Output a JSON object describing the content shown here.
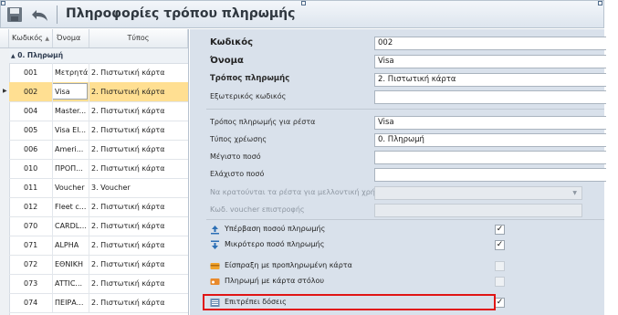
{
  "title": "Πληροφορίες τρόπου πληρωμής",
  "toolbar": {
    "save_icon": "save-icon",
    "undo_icon": "undo-icon"
  },
  "grid": {
    "columns": [
      "Κωδικός",
      "Όνομα",
      "Τύπος"
    ],
    "group": "0. Πληρωμή",
    "rows": [
      {
        "code": "001",
        "name": "Μετρητά",
        "type": "2. Πιστωτική κάρτα"
      },
      {
        "code": "002",
        "name": "Visa",
        "type": "2. Πιστωτική κάρτα"
      },
      {
        "code": "004",
        "name": "Master...",
        "type": "2. Πιστωτική κάρτα"
      },
      {
        "code": "005",
        "name": "Visa El...",
        "type": "2. Πιστωτική κάρτα"
      },
      {
        "code": "006",
        "name": "Ameri...",
        "type": "2. Πιστωτική κάρτα"
      },
      {
        "code": "010",
        "name": "ΠΡΟΠ...",
        "type": "2. Πιστωτική κάρτα"
      },
      {
        "code": "011",
        "name": "Voucher",
        "type": "3. Voucher"
      },
      {
        "code": "012",
        "name": "Fleet c...",
        "type": "2. Πιστωτική κάρτα"
      },
      {
        "code": "070",
        "name": "CARDL...",
        "type": "2. Πιστωτική κάρτα"
      },
      {
        "code": "071",
        "name": "ALPHA",
        "type": "2. Πιστωτική κάρτα"
      },
      {
        "code": "072",
        "name": "ΕΘΝΙΚΗ",
        "type": "2. Πιστωτική κάρτα"
      },
      {
        "code": "073",
        "name": "ATTIC...",
        "type": "2. Πιστωτική κάρτα"
      },
      {
        "code": "074",
        "name": "ΠΕΙΡΑ...",
        "type": "2. Πιστωτική κάρτα"
      }
    ],
    "selected_index": 1
  },
  "form": {
    "code_label": "Κωδικός",
    "code_value": "002",
    "name_label": "Όνομα",
    "name_value": "Visa",
    "method_label": "Τρόπος πληρωμής",
    "method_value": "2. Πιστωτική κάρτα",
    "ext_code_label": "Εξωτερικός κωδικός",
    "ext_code_value": "",
    "change_method_label": "Τρόπος πληρωμής για ρέστα",
    "change_method_value": "Visa",
    "charge_type_label": "Τύπος χρέωσης",
    "charge_type_value": "0. Πληρωμή",
    "max_label": "Μέγιστο ποσό",
    "max_value": "",
    "min_label": "Ελάχιστο ποσό",
    "min_value": "",
    "keep_change_label": "Να κρατούνται τα ρέστα για μελλοντική χρήση",
    "voucher_code_label": "Κωδ. voucher επιστροφής"
  },
  "options": [
    {
      "label": "Υπέρβαση ποσού πληρωμής",
      "checked": true,
      "enabled": true,
      "icon": "arrow-up-icon"
    },
    {
      "label": "Μικρότερο ποσό πληρωμής",
      "checked": true,
      "enabled": true,
      "icon": "arrow-down-icon"
    },
    {
      "label": "Είσπραξη με προπληρωμένη κάρτα",
      "checked": false,
      "enabled": false,
      "icon": "prepaid-card-icon"
    },
    {
      "label": "Πληρωμή με κάρτα στόλου",
      "checked": false,
      "enabled": false,
      "icon": "fleet-card-icon"
    },
    {
      "label": "Επιτρέπει δόσεις",
      "checked": true,
      "enabled": true,
      "icon": "installments-icon"
    }
  ],
  "colors": {
    "selected_row": "#ffdf92",
    "highlight_border": "#e01515",
    "panel_bg": "#d9e1eb"
  }
}
